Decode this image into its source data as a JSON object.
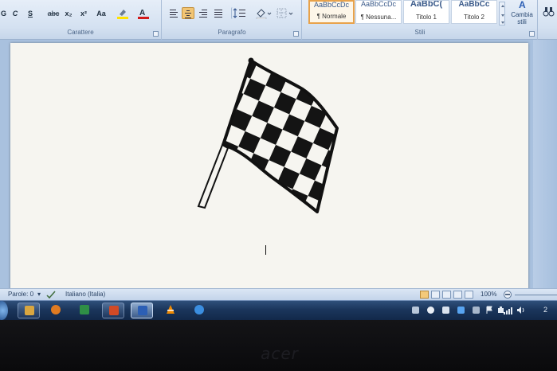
{
  "ribbon": {
    "font_group": {
      "label": "Carattere",
      "buttons": [
        "G",
        "C",
        "S",
        "abc",
        "x₂",
        "x²",
        "Aa"
      ],
      "highlight_color": "#ffe200",
      "font_color": "#d21a1a"
    },
    "paragraph_group": {
      "label": "Paragrafo"
    },
    "styles_group": {
      "label": "Stili",
      "styles": [
        {
          "preview": "AaBbCcDc",
          "name": "¶ Normale",
          "selected": true
        },
        {
          "preview": "AaBbCcDc",
          "name": "¶ Nessuna...",
          "selected": false
        },
        {
          "preview": "AaBbC(",
          "name": "Titolo 1",
          "selected": false
        },
        {
          "preview": "AaBbCc",
          "name": "Titolo 2",
          "selected": false
        }
      ],
      "change_styles_label": "Cambia stili"
    }
  },
  "document": {
    "image_icon": "checkered-flag-icon"
  },
  "status_bar": {
    "word_count": "Parole: 0",
    "language": "Italiano (Italia)",
    "zoom": "100%"
  },
  "taskbar": {
    "items": [
      {
        "icon": "windows-explorer-icon",
        "color": "#d9a640"
      },
      {
        "icon": "media-player-icon",
        "color": "#e07b21"
      },
      {
        "icon": "excel-icon",
        "color": "#2f8f46"
      },
      {
        "icon": "powerpoint-icon",
        "color": "#d24a26"
      },
      {
        "icon": "word-icon",
        "color": "#2c5fb5"
      },
      {
        "icon": "vlc-icon",
        "color": "#f08a00"
      },
      {
        "icon": "browser-icon",
        "color": "#3b8ee0"
      }
    ],
    "clock": "2"
  },
  "monitor": {
    "brand": "acer"
  }
}
